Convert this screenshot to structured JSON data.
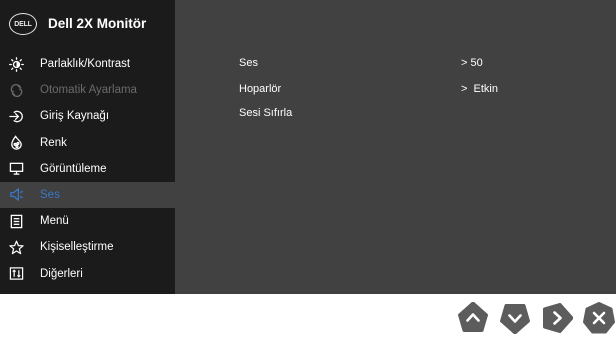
{
  "header": {
    "logo_text": "DELL",
    "title": "Dell 2X Monitör"
  },
  "sidebar": {
    "items": [
      {
        "label": "Parlaklık/Kontrast",
        "icon": "brightness-icon",
        "state": "normal"
      },
      {
        "label": "Otomatik Ayarlama",
        "icon": "auto-adjust-icon",
        "state": "disabled"
      },
      {
        "label": "Giriş Kaynağı",
        "icon": "input-source-icon",
        "state": "normal"
      },
      {
        "label": "Renk",
        "icon": "color-icon",
        "state": "normal"
      },
      {
        "label": "Görüntüleme",
        "icon": "display-icon",
        "state": "normal"
      },
      {
        "label": "Ses",
        "icon": "speaker-icon",
        "state": "active"
      },
      {
        "label": "Menü",
        "icon": "menu-icon",
        "state": "normal"
      },
      {
        "label": "Kişiselleştirme",
        "icon": "star-icon",
        "state": "normal"
      },
      {
        "label": "Diğerleri",
        "icon": "others-icon",
        "state": "normal"
      }
    ]
  },
  "content": {
    "rows": [
      {
        "label": "Ses",
        "value": "> 50"
      },
      {
        "label": "Hoparlör",
        "value": ">  Etkin"
      },
      {
        "label": "Sesi Sıfırla",
        "value": ""
      }
    ]
  },
  "nav_buttons": [
    "up-button",
    "down-button",
    "right-button",
    "close-button"
  ],
  "colors": {
    "osd_background": "#414141",
    "sidebar_background": "#1b1b1b",
    "active_text": "#3a78c6",
    "disabled_text": "#6a6a6a",
    "nav_button": "#5c5c5c"
  }
}
